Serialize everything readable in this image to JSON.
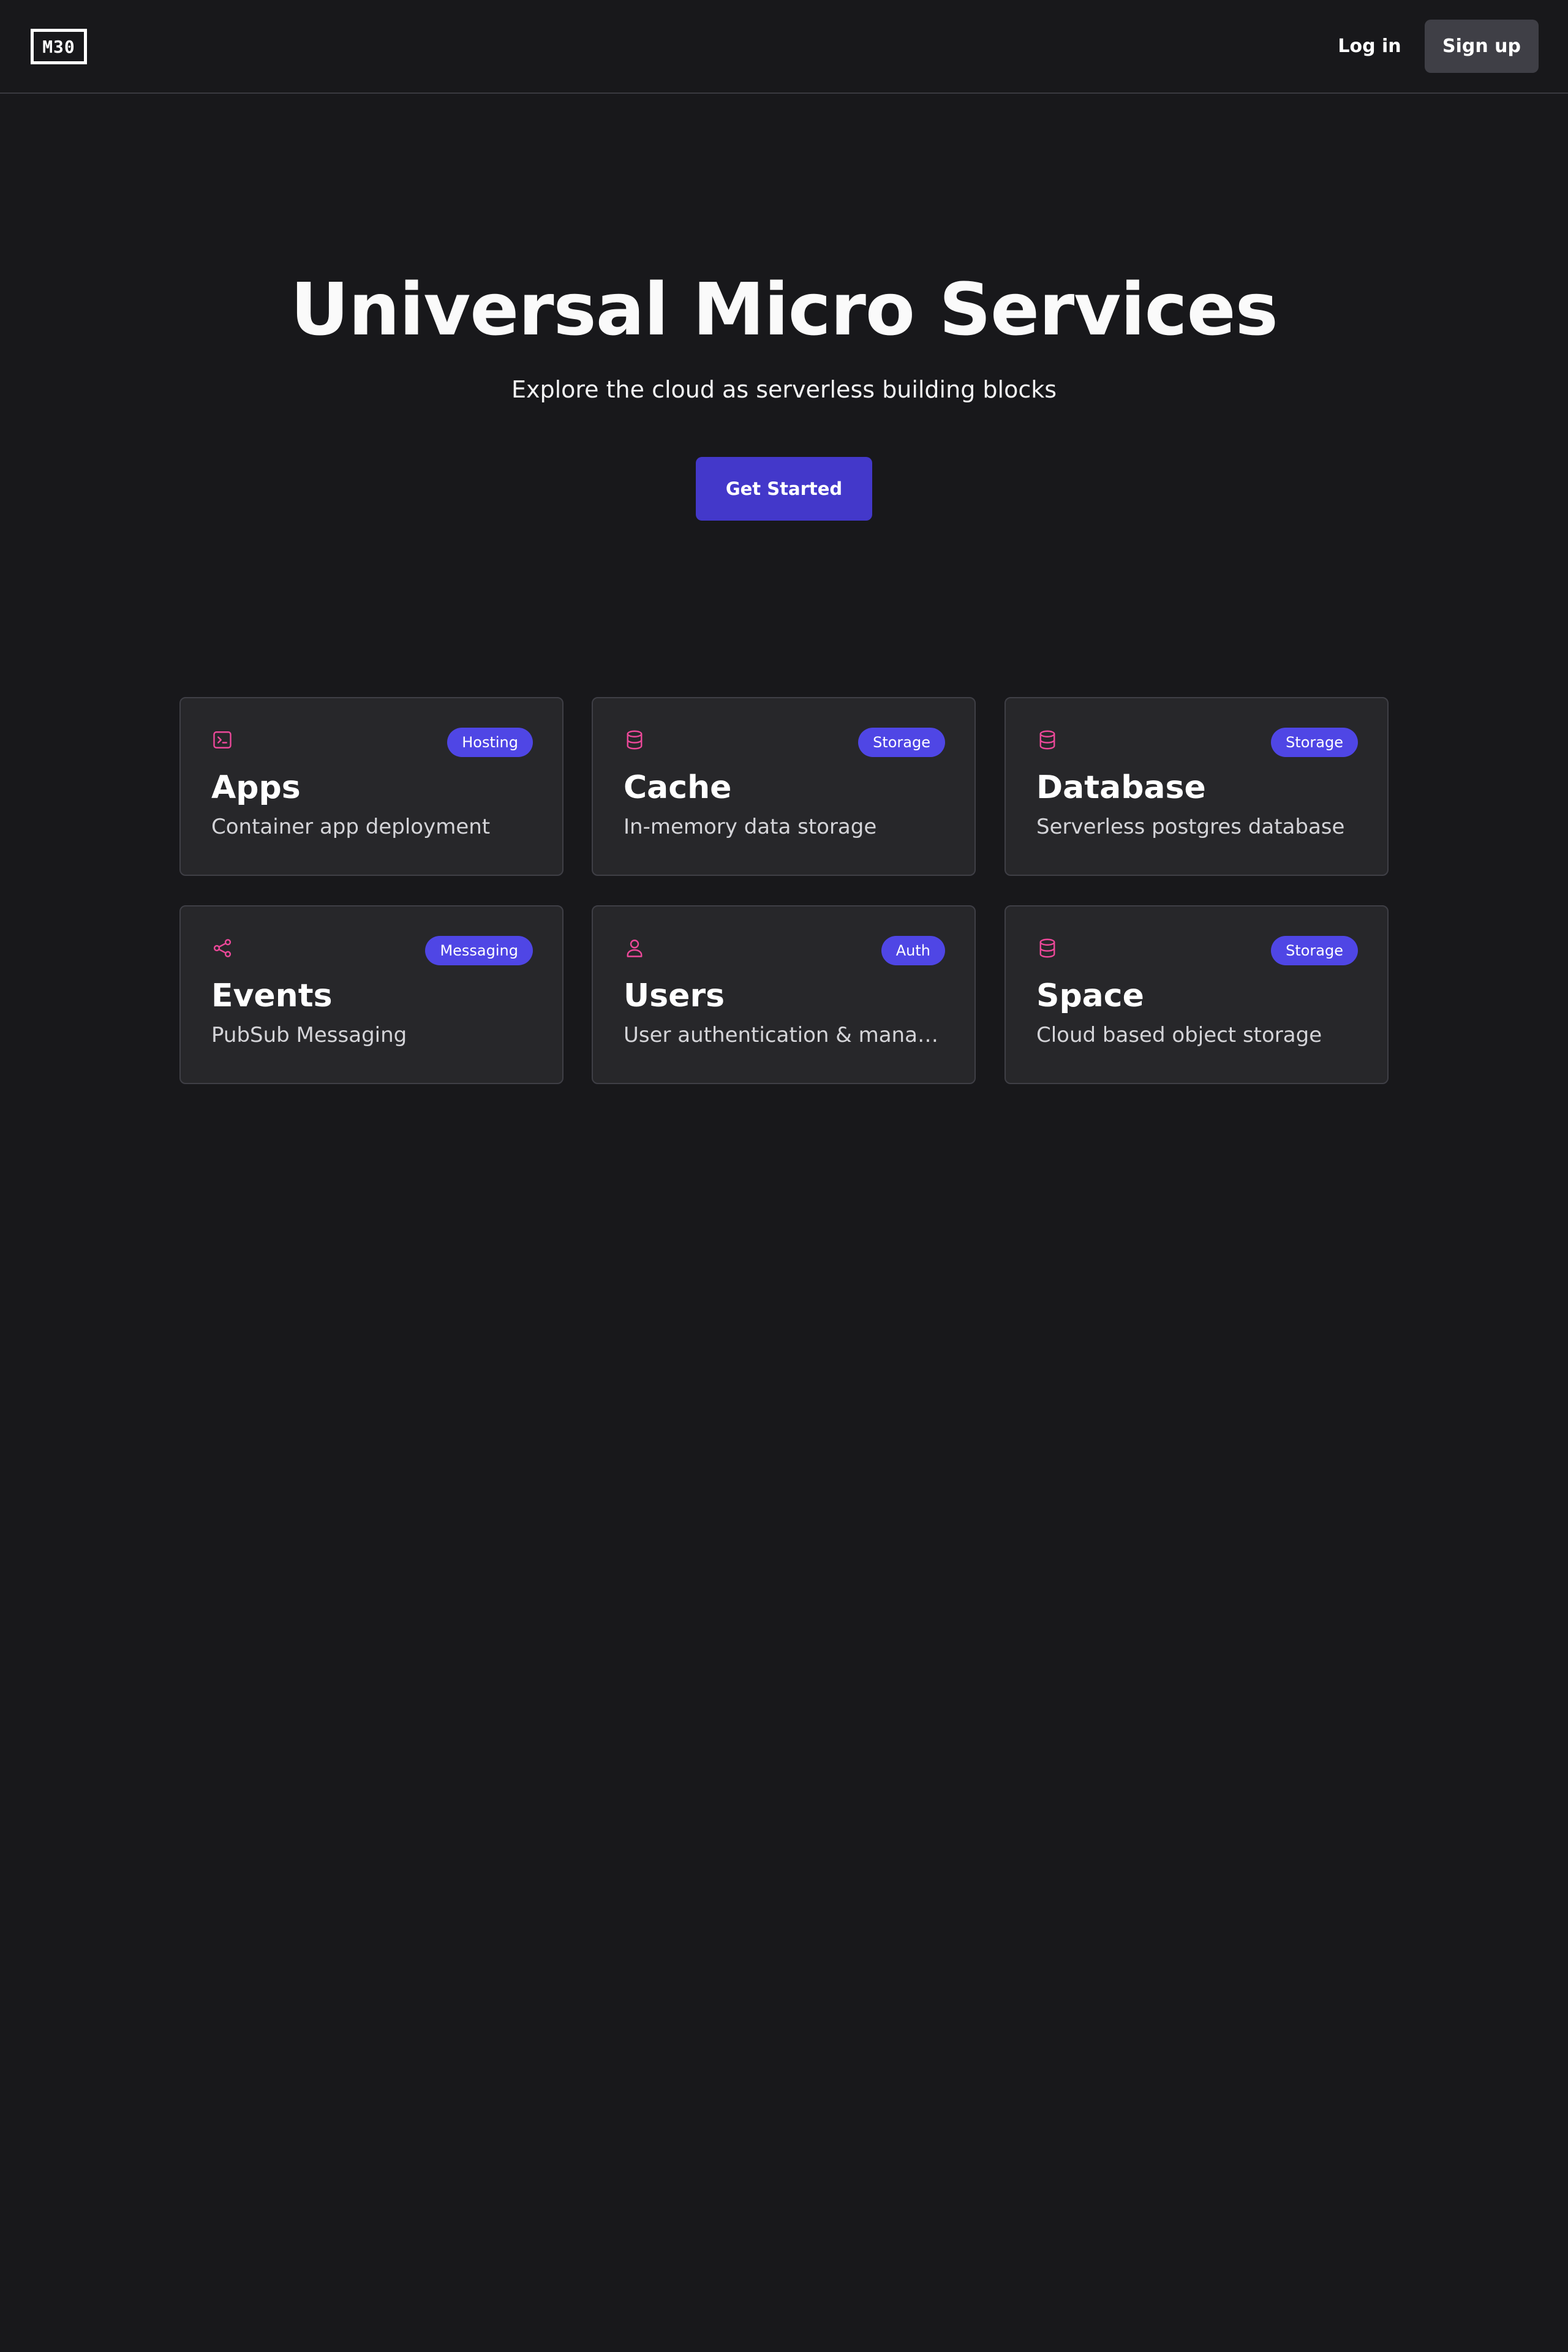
{
  "header": {
    "logo": "M30",
    "login_label": "Log in",
    "signup_label": "Sign up"
  },
  "hero": {
    "title": "Universal Micro Services",
    "subtitle": "Explore the cloud as serverless building blocks",
    "cta_label": "Get Started"
  },
  "colors": {
    "background": "#18181b",
    "card_background": "#27272a",
    "accent": "#4f46e5",
    "cta": "#4338ca",
    "icon": "#ec4899"
  },
  "services": [
    {
      "title": "Apps",
      "description": "Container app deployment",
      "badge": "Hosting",
      "icon": "terminal-icon"
    },
    {
      "title": "Cache",
      "description": "In-memory data storage",
      "badge": "Storage",
      "icon": "database-icon"
    },
    {
      "title": "Database",
      "description": "Serverless postgres database",
      "badge": "Storage",
      "icon": "database-icon"
    },
    {
      "title": "Events",
      "description": "PubSub Messaging",
      "badge": "Messaging",
      "icon": "share-icon"
    },
    {
      "title": "Users",
      "description": "User authentication & manage…",
      "badge": "Auth",
      "icon": "user-icon"
    },
    {
      "title": "Space",
      "description": "Cloud based object storage",
      "badge": "Storage",
      "icon": "database-icon"
    }
  ]
}
